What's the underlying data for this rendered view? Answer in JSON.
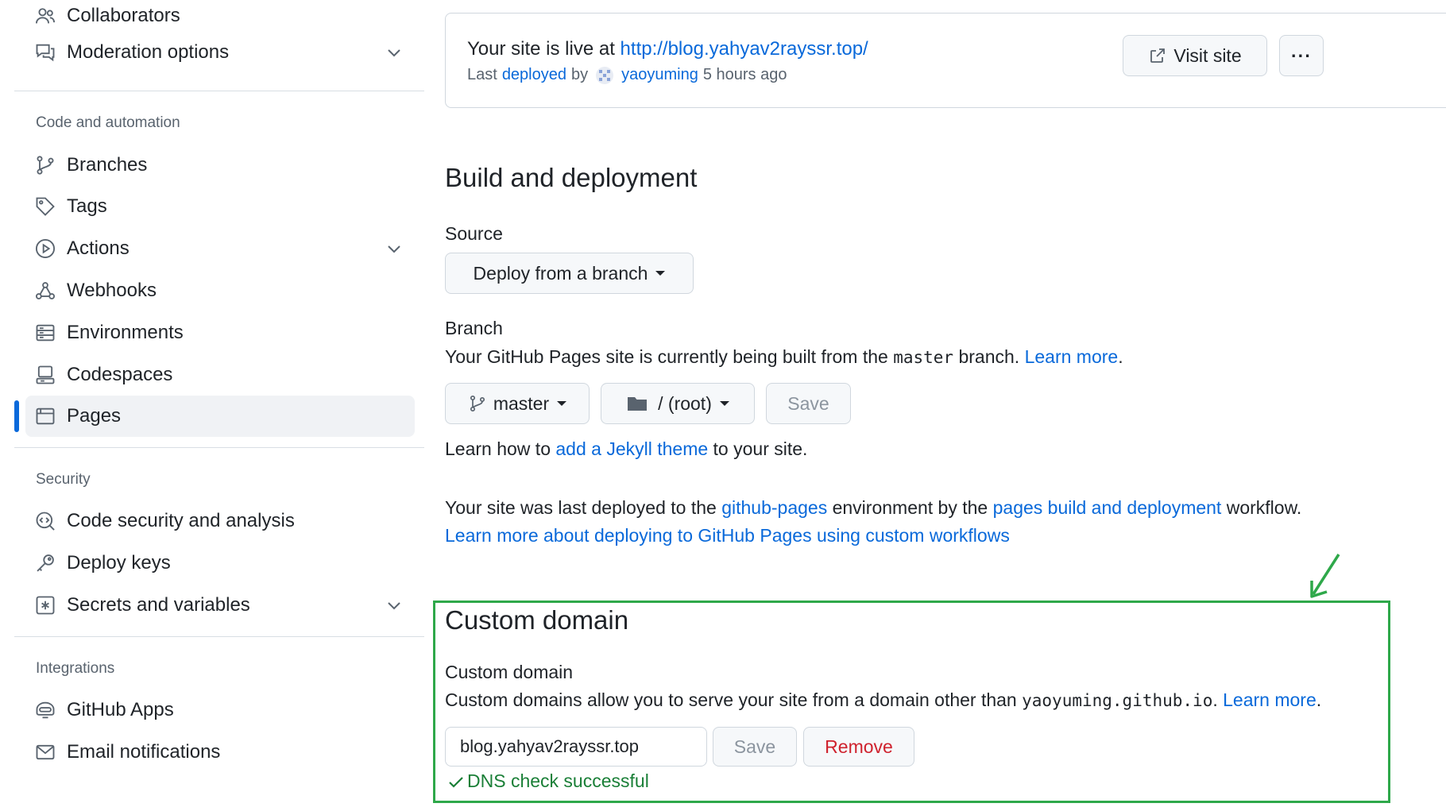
{
  "sidebar": {
    "access_items": [
      {
        "label": "Collaborators",
        "icon": "people-icon"
      },
      {
        "label": "Moderation options",
        "icon": "comment-discussion-icon"
      }
    ],
    "sections": {
      "code_automation": "Code and automation",
      "security": "Security",
      "integrations": "Integrations"
    },
    "code_items": [
      {
        "label": "Branches",
        "icon": "git-branch-icon"
      },
      {
        "label": "Tags",
        "icon": "tag-icon"
      },
      {
        "label": "Actions",
        "icon": "play-icon"
      },
      {
        "label": "Webhooks",
        "icon": "webhook-icon"
      },
      {
        "label": "Environments",
        "icon": "server-icon"
      },
      {
        "label": "Codespaces",
        "icon": "codespaces-icon"
      },
      {
        "label": "Pages",
        "icon": "browser-icon",
        "active": true
      }
    ],
    "security_items": [
      {
        "label": "Code security and analysis",
        "icon": "codescan-icon"
      },
      {
        "label": "Deploy keys",
        "icon": "key-icon"
      },
      {
        "label": "Secrets and variables",
        "icon": "key-asterisk-icon"
      }
    ],
    "integration_items": [
      {
        "label": "GitHub Apps",
        "icon": "hubot-icon"
      },
      {
        "label": "Email notifications",
        "icon": "mail-icon"
      }
    ]
  },
  "live": {
    "prefix": "Your site is live at ",
    "url": "http://blog.yahyav2rayssr.top/",
    "last": "Last",
    "deployed": "deployed",
    "by": "by",
    "user": "yaoyuming",
    "time": "5 hours ago",
    "visit_label": "Visit site",
    "more_label": "···"
  },
  "build": {
    "title": "Build and deployment",
    "source_label": "Source",
    "source_value": "Deploy from a branch",
    "branch_label": "Branch",
    "branch_desc_1": "Your GitHub Pages site is currently being built from the ",
    "branch_code": "master",
    "branch_desc_2": " branch. ",
    "learn_more": "Learn more",
    "period": ".",
    "branch_value": "master",
    "folder_value": "/ (root)",
    "save_label": "Save",
    "jekyll_1": "Learn how to ",
    "jekyll_link": "add a Jekyll theme",
    "jekyll_2": " to your site.",
    "deployed_1": "Your site was last deployed to the ",
    "deployed_env": "github-pages",
    "deployed_2": " environment by the ",
    "deployed_workflow": "pages build and deployment",
    "deployed_3": " workflow.",
    "custom_workflows_link": "Learn more about deploying to GitHub Pages using custom workflows"
  },
  "custom_domain": {
    "title": "Custom domain",
    "label": "Custom domain",
    "desc_1": "Custom domains allow you to serve your site from a domain other than ",
    "desc_code": "yaoyuming.github.io",
    "desc_2": ". ",
    "learn_more": "Learn more",
    "period": ".",
    "input_value": "blog.yahyav2rayssr.top",
    "save_label": "Save",
    "remove_label": "Remove",
    "dns_status": "DNS check successful"
  },
  "colors": {
    "link": "#0969da",
    "highlight": "#2ea84a",
    "success": "#1a7f37",
    "danger": "#cf222e",
    "active_bar": "#0969da"
  }
}
